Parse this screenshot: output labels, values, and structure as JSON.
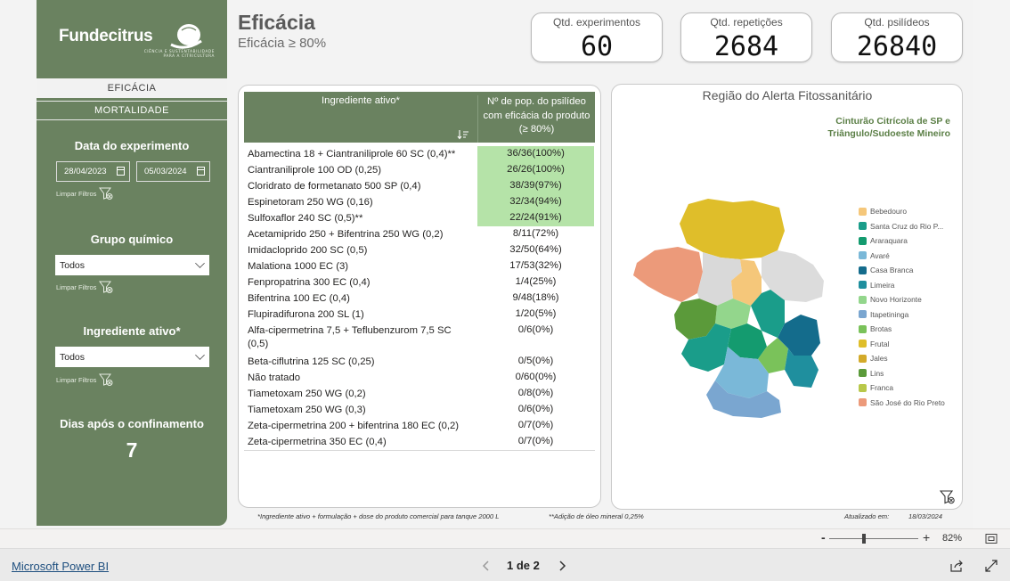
{
  "brand": {
    "name": "Fundecitrus",
    "tagline_1": "CIÊNCIA E SUSTENTABILIDADE",
    "tagline_2": "PARA A CITRICULTURA"
  },
  "nav": {
    "eficacia": "EFICÁCIA",
    "mortalidade": "MORTALIDADE"
  },
  "filters": {
    "date_title": "Data do experimento",
    "date_start": "28/04/2023",
    "date_end": "05/03/2024",
    "clear_label": "Limpar Filtros",
    "grupo_title": "Grupo químico",
    "grupo_value": "Todos",
    "ingrediente_title": "Ingrediente ativo*",
    "ingrediente_value": "Todos",
    "dias_title": "Dias após o confinamento",
    "dias_value": "7"
  },
  "header": {
    "title": "Eficácia",
    "subtitle": "Eficácia ≥ 80%"
  },
  "kpis": {
    "experimentos_label": "Qtd. experimentos",
    "experimentos_value": "60",
    "repeticoes_label": "Qtd. repetições",
    "repeticoes_value": "2684",
    "psilideos_label": "Qtd. psilídeos",
    "psilideos_value": "26840"
  },
  "table": {
    "col1": "Ingrediente ativo*",
    "col2": "Nº de pop. do psilídeo com eficácia do produto (≥ 80%)",
    "rows": [
      {
        "name": "Abamectina 18 + Ciantraniliprole 60 SC (0,4)**",
        "value": "36/36(100%)",
        "highlight": true
      },
      {
        "name": "Ciantraniliprole 100 OD (0,25)",
        "value": "26/26(100%)",
        "highlight": true
      },
      {
        "name": "Cloridrato de formetanato 500 SP (0,4)",
        "value": "38/39(97%)",
        "highlight": true
      },
      {
        "name": "Espinetoram 250 WG (0,16)",
        "value": "32/34(94%)",
        "highlight": true
      },
      {
        "name": "Sulfoxaflor 240 SC (0,5)**",
        "value": "22/24(91%)",
        "highlight": true
      },
      {
        "name": "Acetamiprido 250 + Bifentrina 250 WG (0,2)",
        "value": "8/11(72%)",
        "highlight": false
      },
      {
        "name": "Imidacloprido 200 SC (0,5)",
        "value": "32/50(64%)",
        "highlight": false
      },
      {
        "name": "Malationa 1000 EC (3)",
        "value": "17/53(32%)",
        "highlight": false
      },
      {
        "name": "Fenpropatrina 300 EC (0,4)",
        "value": "1/4(25%)",
        "highlight": false
      },
      {
        "name": "Bifentrina 100 EC (0,4)",
        "value": "9/48(18%)",
        "highlight": false
      },
      {
        "name": "Flupiradifurona 200 SL (1)",
        "value": "1/20(5%)",
        "highlight": false
      },
      {
        "name": "Alfa-cipermetrina 7,5 + Teflubenzurom 7,5 SC (0,5)",
        "value": "0/6(0%)",
        "highlight": false
      },
      {
        "name": "Beta-ciflutrina 125 SC (0,25)",
        "value": "0/5(0%)",
        "highlight": false
      },
      {
        "name": "Não tratado",
        "value": "0/60(0%)",
        "highlight": false
      },
      {
        "name": "Tiametoxam 250 WG (0,2)",
        "value": "0/8(0%)",
        "highlight": false
      },
      {
        "name": "Tiametoxam 250 WG (0,3)",
        "value": "0/6(0%)",
        "highlight": false
      },
      {
        "name": "Zeta-cipermetrina 200 + bifentrina 180 EC (0,2)",
        "value": "0/7(0%)",
        "highlight": false
      },
      {
        "name": "Zeta-cipermetrina 350 EC (0,4)",
        "value": "0/7(0%)",
        "highlight": false
      }
    ]
  },
  "map": {
    "title": "Região do Alerta Fitossanitário",
    "subtitle_1": "Cinturão Citrícola de SP e",
    "subtitle_2": "Triângulo/Sudoeste Mineiro",
    "legend": [
      {
        "label": "Bebedouro",
        "color": "#f5c77a"
      },
      {
        "label": "Santa Cruz do Rio P...",
        "color": "#1a9d8a"
      },
      {
        "label": "Araraquara",
        "color": "#149b6f"
      },
      {
        "label": "Avaré",
        "color": "#7ab8d8"
      },
      {
        "label": "Casa Branca",
        "color": "#146c8c"
      },
      {
        "label": "Limeira",
        "color": "#1f8f9e"
      },
      {
        "label": "Novo Horizonte",
        "color": "#93d68c"
      },
      {
        "label": "Itapetininga",
        "color": "#7aa6d0"
      },
      {
        "label": "Brotas",
        "color": "#7ac25a"
      },
      {
        "label": "Frutal",
        "color": "#dfbe2a"
      },
      {
        "label": "Jales",
        "color": "#d3aa2a"
      },
      {
        "label": "Lins",
        "color": "#5b9a3a"
      },
      {
        "label": "Franca",
        "color": "#b8c84a"
      },
      {
        "label": "São José do Rio Preto",
        "color": "#ec9a7a"
      }
    ]
  },
  "footer": {
    "note_1": "*Ingrediente ativo + formulação + dose do produto comercial para tanque 2000 L",
    "note_2": "**Adição de óleo mineral 0,25%",
    "updated_label": "Atualizado em:",
    "updated_value": "18/03/2024"
  },
  "viewer": {
    "zoom_minus": "-",
    "zoom_plus": "+",
    "zoom_level": "82%",
    "product_link": "Microsoft Power BI",
    "page_indicator": "1 de 2"
  }
}
